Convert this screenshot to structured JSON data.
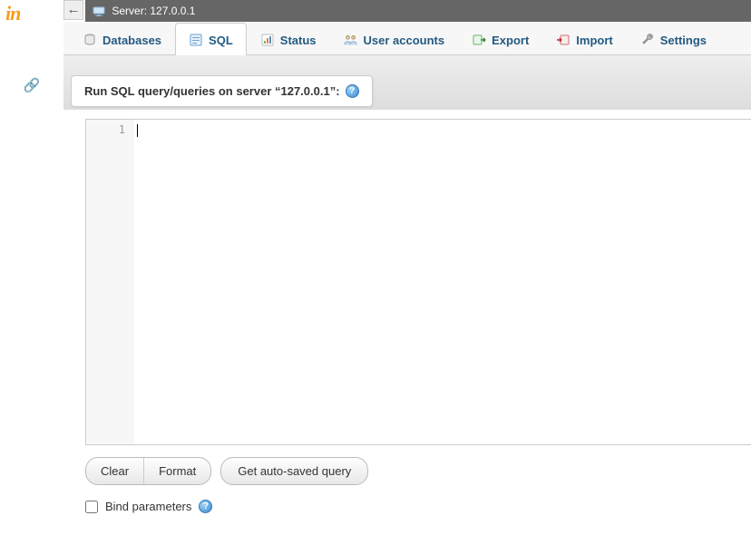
{
  "logo_text": "in",
  "breadcrumb": {
    "label": "Server: 127.0.0.1"
  },
  "tabs": [
    {
      "label": "Databases"
    },
    {
      "label": "SQL"
    },
    {
      "label": "Status"
    },
    {
      "label": "User accounts"
    },
    {
      "label": "Export"
    },
    {
      "label": "Import"
    },
    {
      "label": "Settings"
    }
  ],
  "active_tab_index": 1,
  "panel": {
    "title": "Run SQL query/queries on server “127.0.0.1”:"
  },
  "editor": {
    "line_number": "1",
    "content": ""
  },
  "buttons": {
    "clear": "Clear",
    "format": "Format",
    "auto_saved": "Get auto-saved query"
  },
  "bind_parameters": {
    "label": "Bind parameters",
    "checked": false
  }
}
